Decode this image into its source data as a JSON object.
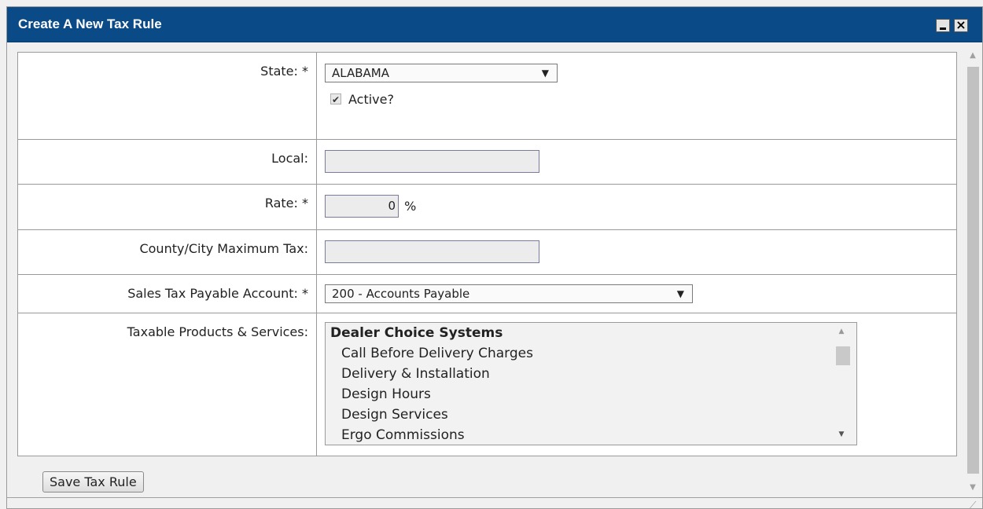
{
  "dialog": {
    "title": "Create A New Tax Rule",
    "minimize_icon": "minimize-icon",
    "close_icon": "close-icon"
  },
  "form": {
    "state": {
      "label": "State: *",
      "selected": "ALABAMA",
      "active_label": "Active?",
      "active_checked": true
    },
    "local": {
      "label": "Local:",
      "value": ""
    },
    "rate": {
      "label": "Rate: *",
      "value": "0",
      "unit": "%"
    },
    "county_max": {
      "label": "County/City Maximum Tax:",
      "value": ""
    },
    "sales_tax_account": {
      "label": "Sales Tax Payable Account: *",
      "selected": "200 - Accounts Payable"
    },
    "taxable": {
      "label": "Taxable Products & Services:",
      "group": "Dealer Choice Systems",
      "items": [
        "Call Before Delivery Charges",
        "Delivery & Installation",
        "Design Hours",
        "Design Services",
        "Ergo Commissions"
      ]
    }
  },
  "buttons": {
    "save": "Save Tax Rule"
  }
}
